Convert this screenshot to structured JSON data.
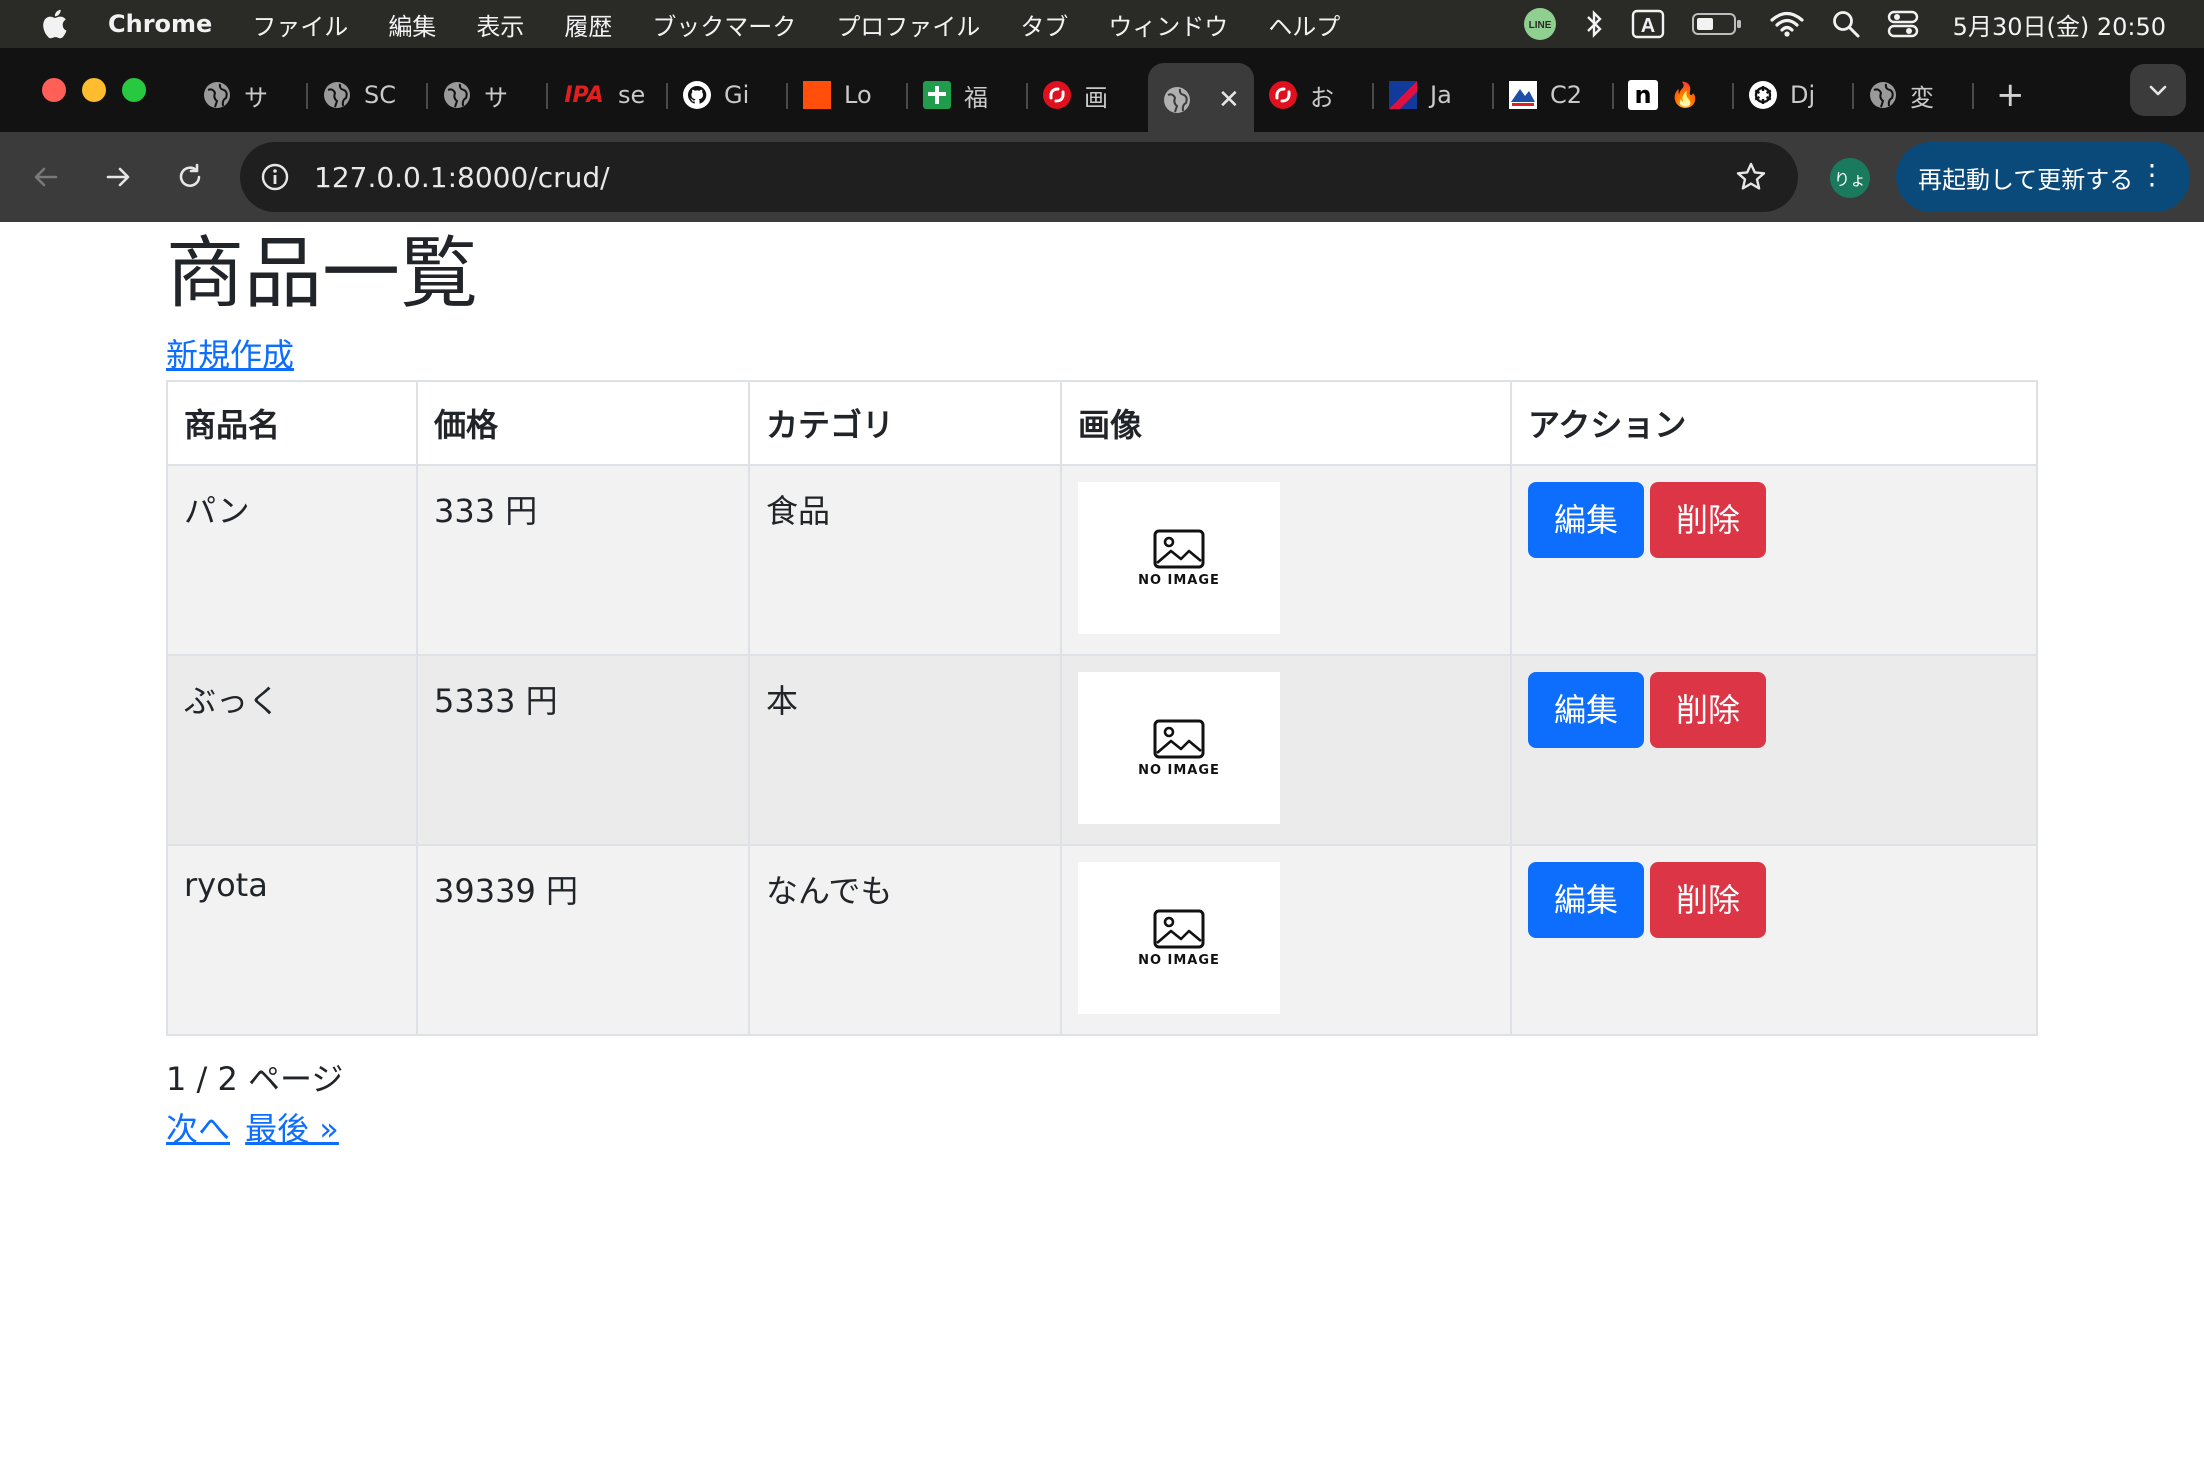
{
  "menubar": {
    "app_name": "Chrome",
    "items": [
      "ファイル",
      "編集",
      "表示",
      "履歴",
      "ブックマーク",
      "プロファイル",
      "タブ",
      "ウィンドウ",
      "ヘルプ"
    ],
    "status_icons": [
      "line-icon",
      "bluetooth-icon",
      "input-source-icon",
      "battery-icon",
      "wifi-icon",
      "spotlight-icon",
      "control-center-icon"
    ],
    "input_source": "A",
    "line_label": "LINE",
    "clock": "5月30日(金)  20:50"
  },
  "tabs": [
    {
      "title": "サ",
      "icon": "globe-icon"
    },
    {
      "title": "SC",
      "icon": "globe-icon"
    },
    {
      "title": "サ",
      "icon": "globe-icon"
    },
    {
      "title": "se",
      "icon": "ipa-icon",
      "icon_text": "IPA"
    },
    {
      "title": "Gi",
      "icon": "github-icon"
    },
    {
      "title": "Lo",
      "icon": "orange-square-icon"
    },
    {
      "title": "福",
      "icon": "green-plus-icon"
    },
    {
      "title": "画",
      "icon": "red-swirl-icon"
    },
    {
      "title": "",
      "icon": "globe-icon",
      "active": true
    },
    {
      "title": "お",
      "icon": "red-swirl-icon"
    },
    {
      "title": "Ja",
      "icon": "flag-icon"
    },
    {
      "title": "C2",
      "icon": "mountain-icon"
    },
    {
      "title": "",
      "icon": "notion-icon",
      "icon_text": "n"
    },
    {
      "title": "Dj",
      "icon": "openai-icon"
    },
    {
      "title": "変",
      "icon": "globe-icon"
    }
  ],
  "toolbar": {
    "url": "127.0.0.1:8000/crud/",
    "profile_label": "りょ",
    "update_label": "再起動して更新する"
  },
  "page": {
    "title": "商品一覧",
    "new_link": "新規作成",
    "columns": [
      "商品名",
      "価格",
      "カテゴリ",
      "画像",
      "アクション"
    ],
    "rows": [
      {
        "name": "パン",
        "price": "333 円",
        "category": "食品",
        "image_label": "NO IMAGE"
      },
      {
        "name": "ぶっく",
        "price": "5333 円",
        "category": "本",
        "image_label": "NO IMAGE"
      },
      {
        "name": "ryota",
        "price": "39339 円",
        "category": "なんでも",
        "image_label": "NO IMAGE"
      }
    ],
    "edit_label": "編集",
    "delete_label": "削除",
    "pager_info": "1 / 2 ページ",
    "next_label": "次へ",
    "last_label": "最後 »"
  },
  "colors": {
    "primary": "#0d6efd",
    "danger": "#dc3545",
    "update_button": "#0a4a7a"
  }
}
